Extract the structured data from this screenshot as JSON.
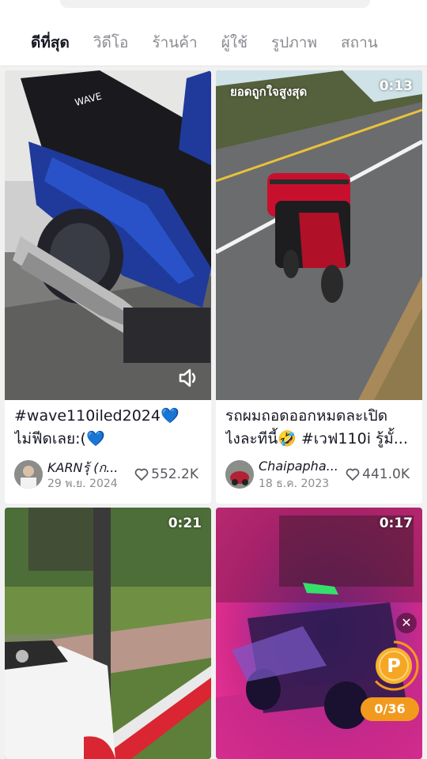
{
  "tabs": [
    {
      "label": "ดีที่สุด",
      "active": true
    },
    {
      "label": "วิดีโอ",
      "active": false
    },
    {
      "label": "ร้านค้า",
      "active": false
    },
    {
      "label": "ผู้ใช้",
      "active": false
    },
    {
      "label": "รูปภาพ",
      "active": false
    },
    {
      "label": "สถาน",
      "active": false
    }
  ],
  "videos": [
    {
      "caption_line1": "#wave110iled2024💙",
      "caption_line2": "ไม่ฟีดเลย:(💙",
      "author": "KARNรุ้ (ก...",
      "date": "29 พ.ย. 2024",
      "likes": "552.2K",
      "sound_icon": "speaker-icon"
    },
    {
      "badge": "ยอดถูกใจสูงสุด",
      "duration": "0:13",
      "caption_line1": "รถผมถอดออกหมดละเปิด",
      "caption_line2": "ไงละทีนี้🤣 #เวฟ110i รู้มั้...",
      "author": "Chaipapha...",
      "date": "18 ธ.ค. 2023",
      "likes": "441.0K"
    },
    {
      "duration": "0:21"
    },
    {
      "duration": "0:17"
    }
  ],
  "coin_widget": {
    "close": "✕",
    "coin_letter": "P",
    "progress": "0/36",
    "accent": "#f29a1d"
  },
  "colors": {
    "text_primary": "#161823",
    "text_secondary": "#8a8b91",
    "background": "#f1f1f2"
  }
}
